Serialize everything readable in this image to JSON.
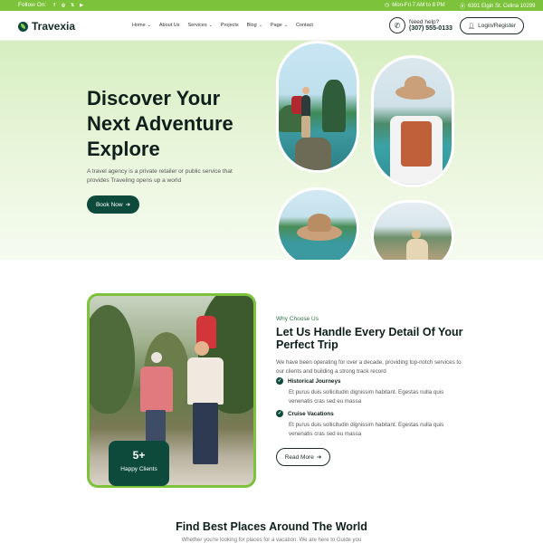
{
  "topbar": {
    "follow_label": "Follow On:",
    "social_icons": [
      "facebook-icon",
      "instagram-icon",
      "x-icon",
      "youtube-icon"
    ],
    "hours": "Mon-Fri 7 AM to 8 PM",
    "address": "6391 Elgin St. Celina 10299"
  },
  "header": {
    "logo": "Travexia",
    "nav": [
      {
        "label": "Home",
        "dropdown": true
      },
      {
        "label": "About Us",
        "dropdown": false
      },
      {
        "label": "Services",
        "dropdown": true
      },
      {
        "label": "Projects",
        "dropdown": false
      },
      {
        "label": "Blog",
        "dropdown": true
      },
      {
        "label": "Page",
        "dropdown": true
      },
      {
        "label": "Contact",
        "dropdown": false
      }
    ],
    "help_label": "Need help?",
    "phone": "(307) 555-0133",
    "login_label": "Login/Register"
  },
  "hero": {
    "title_lines": [
      "Discover Your",
      "Next Adventure",
      "Explore"
    ],
    "description": "A travel agency is a private retailer or public service that provides Traveling opens up a world",
    "cta": "Book Now"
  },
  "why": {
    "eyebrow": "Why Choose Us",
    "title": "Let Us Handle Every Detail Of Your Perfect Trip",
    "description": "We have been operating for over a decade, providing top-notch services to our clients and building a strong track record",
    "features": [
      {
        "title": "Historical Journeys",
        "text": "Et purus duis sollicitudin dignissim habitant. Egestas nulla quis venenatis cras sed eu massa"
      },
      {
        "title": "Cruise Vacations",
        "text": "Et purus duis sollicitudin dignissim habitant. Egestas nulla quis venenatis cras sed eu massa"
      }
    ],
    "button": "Read More",
    "clients_count": "5+",
    "clients_label": "Happy Clients"
  },
  "places": {
    "title": "Find Best Places Around The World",
    "subtitle": "Whether you're looking for places for a vacation. We are here to Guide you"
  },
  "colors": {
    "accent": "#7cc23a",
    "primary": "#0e4a3c",
    "hero_bg": "#e3f3d3"
  }
}
